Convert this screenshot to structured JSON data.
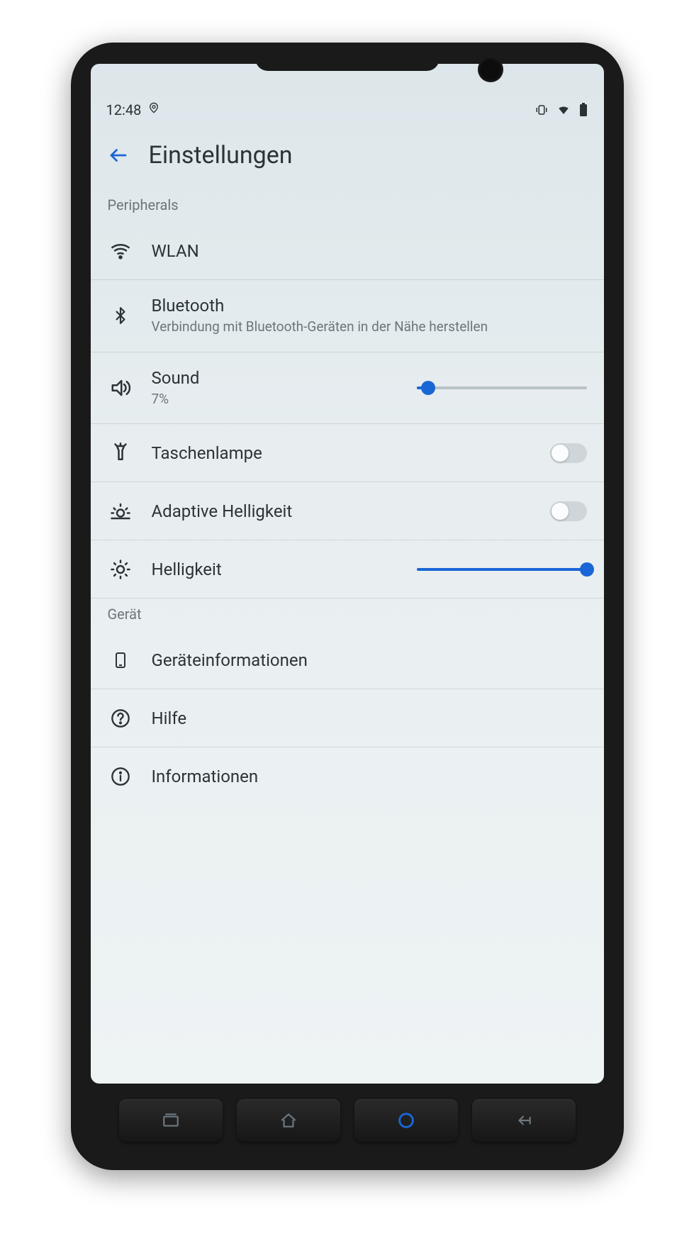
{
  "status": {
    "time": "12:48"
  },
  "header": {
    "title": "Einstellungen"
  },
  "sections": {
    "peripherals": {
      "label": "Peripherals",
      "wlan": {
        "title": "WLAN"
      },
      "bluetooth": {
        "title": "Bluetooth",
        "subtitle": "Verbindung mit Bluetooth-Geräten in der Nähe herstellen"
      },
      "sound": {
        "title": "Sound",
        "subtitle": "7%",
        "value_percent": 7
      },
      "flashlight": {
        "title": "Taschenlampe",
        "enabled": false
      },
      "adaptive_brightness": {
        "title": "Adaptive Helligkeit",
        "enabled": false
      },
      "brightness": {
        "title": "Helligkeit",
        "value_percent": 100
      }
    },
    "device": {
      "label": "Gerät",
      "device_info": {
        "title": "Geräteinformationen"
      },
      "help": {
        "title": "Hilfe"
      },
      "info": {
        "title": "Informationen"
      }
    }
  },
  "colors": {
    "accent": "#1a66d6"
  }
}
